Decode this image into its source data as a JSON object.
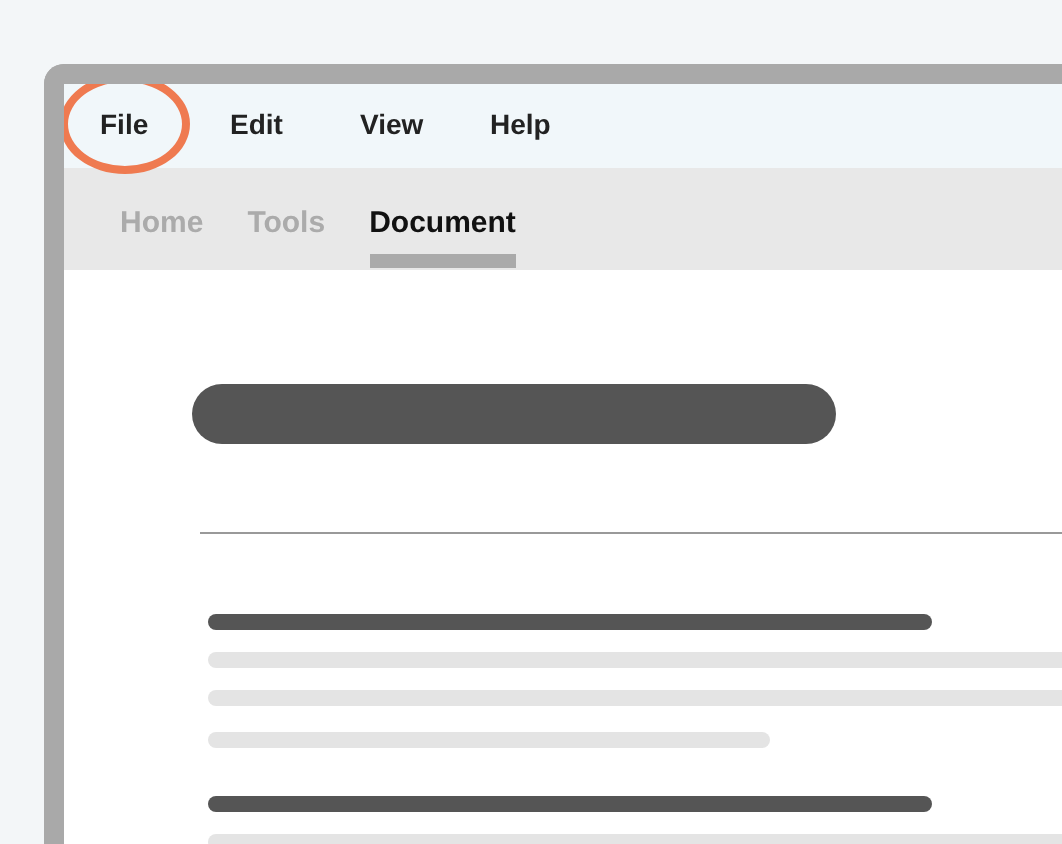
{
  "menu": [
    {
      "label": "File",
      "highlighted": true
    },
    {
      "label": "Edit",
      "highlighted": false
    },
    {
      "label": "View",
      "highlighted": false
    },
    {
      "label": "Help",
      "highlighted": false
    }
  ],
  "tabs": [
    {
      "label": "Home",
      "selected": false
    },
    {
      "label": "Tools",
      "selected": false
    },
    {
      "label": "Document",
      "selected": true
    }
  ],
  "document": {
    "lines": [
      {
        "kind": "heading"
      },
      {
        "kind": "text"
      },
      {
        "kind": "text"
      },
      {
        "kind": "short"
      },
      {
        "kind": "heading"
      },
      {
        "kind": "text"
      }
    ]
  }
}
